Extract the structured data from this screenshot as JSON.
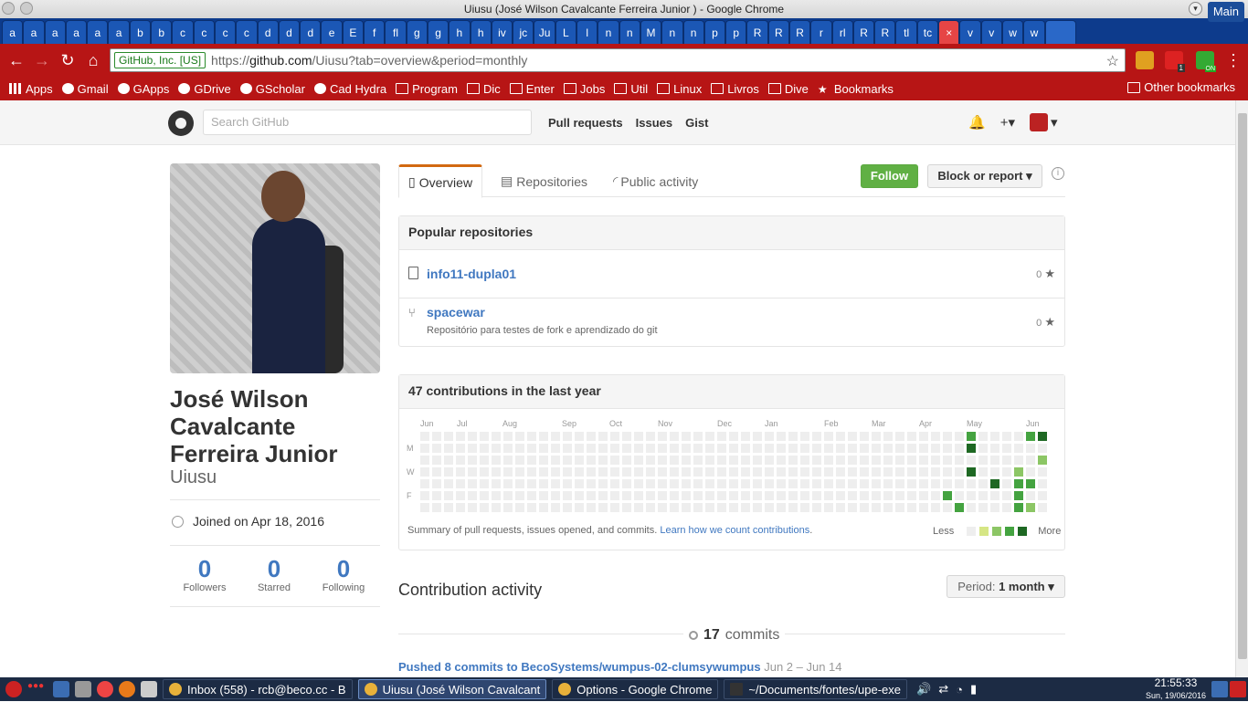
{
  "window": {
    "title": "Uiusu (José Wilson Cavalcante Ferreira Junior ) - Google Chrome"
  },
  "tabs": [
    "a",
    "a",
    "a",
    "a",
    "a",
    "a",
    "b",
    "b",
    "c",
    "c",
    "c",
    "c",
    "d",
    "d",
    "d",
    "e",
    "E",
    "f",
    "fl",
    "g",
    "g",
    "h",
    "h",
    "iv",
    "jc",
    "Ju",
    "L",
    "l",
    "n",
    "n",
    "M",
    "n",
    "n",
    "p",
    "p",
    "R",
    "R",
    "R",
    "r",
    "rl",
    "R",
    "R",
    "tl",
    "tc",
    "×",
    "v",
    "v",
    "w",
    "w"
  ],
  "tabs_main_label": "Main",
  "omnibox": {
    "secure_label": "GitHub, Inc. [US]",
    "url_prefix": "https://",
    "url_host": "github.com",
    "url_rest": "/Uiusu?tab=overview&period=monthly"
  },
  "extensions": {
    "badge": "1",
    "on_label": "ON"
  },
  "bookmarks": {
    "items": [
      "Apps",
      "Gmail",
      "GApps",
      "GDrive",
      "GScholar",
      "Cad Hydra",
      "Program",
      "Dic",
      "Enter",
      "Jobs",
      "Util",
      "Linux",
      "Livros",
      "Dive",
      "Bookmarks"
    ],
    "other": "Other bookmarks"
  },
  "github_header": {
    "search_placeholder": "Search GitHub",
    "nav": [
      "Pull requests",
      "Issues",
      "Gist"
    ]
  },
  "profile": {
    "full_name": "José Wilson Cavalcante Ferreira Junior",
    "login": "Uiusu",
    "joined": "Joined on Apr 18, 2016",
    "stats": [
      {
        "value": "0",
        "label": "Followers"
      },
      {
        "value": "0",
        "label": "Starred"
      },
      {
        "value": "0",
        "label": "Following"
      }
    ]
  },
  "profile_tabs": [
    "Overview",
    "Repositories",
    "Public activity"
  ],
  "actions": {
    "follow": "Follow",
    "block": "Block or report ▾",
    "info": "i"
  },
  "popular_repos": {
    "title": "Popular repositories",
    "items": [
      {
        "name": "info11-dupla01",
        "description": "",
        "stars": "0"
      },
      {
        "name": "spacewar",
        "description": "Repositório para testes de fork e aprendizado do git",
        "stars": "0"
      }
    ]
  },
  "contributions": {
    "title": "47 contributions in the last year",
    "months": [
      "Jun",
      "Jul",
      "Aug",
      "Sep",
      "Oct",
      "Nov",
      "Dec",
      "Jan",
      "Feb",
      "Mar",
      "Apr",
      "May",
      "Jun"
    ],
    "day_labels": [
      "M",
      "W",
      "F"
    ],
    "summary": "Summary of pull requests, issues opened, and commits.",
    "learn_link": "Learn how we count contributions",
    "legend_less": "Less",
    "legend_more": "More",
    "colors": [
      "#eeeeee",
      "#d6e685",
      "#8cc665",
      "#44a340",
      "#1e6823"
    ]
  },
  "activity": {
    "title": "Contribution activity",
    "period_label": "Period:",
    "period_value": "1 month ▾",
    "commits_count": "17",
    "commits_word": "commits",
    "push_text": "Pushed 8 commits to BecoSystems/wumpus-02-clumsywumpus",
    "push_dates": "Jun 2 – Jun 14"
  },
  "taskbar": {
    "tasks": [
      "Inbox (558) - rcb@beco.cc - B",
      "Uiusu (José Wilson Cavalcant",
      "Options - Google Chrome",
      "~/Documents/fontes/upe-exe"
    ],
    "time": "21:55:33",
    "date": "Sun, 19/06/2016"
  }
}
